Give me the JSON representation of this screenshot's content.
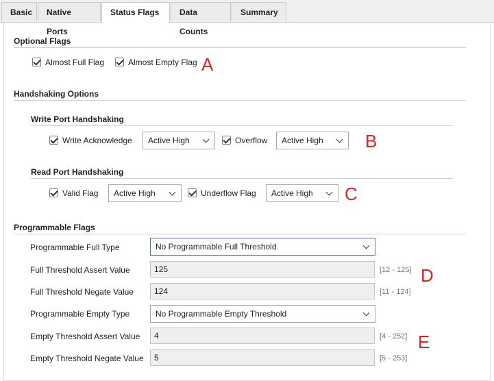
{
  "tabs": [
    "Basic",
    "Native Ports",
    "Status Flags",
    "Data Counts",
    "Summary"
  ],
  "optional_flags": {
    "title": "Optional Flags",
    "almost_full": "Almost Full Flag",
    "almost_empty": "Almost Empty Flag"
  },
  "handshaking": {
    "title": "Handshaking Options",
    "write": {
      "title": "Write Port Handshaking",
      "ack": "Write Acknowledge",
      "ack_select": "Active High",
      "overflow": "Overflow",
      "overflow_select": "Active High"
    },
    "read": {
      "title": "Read Port Handshaking",
      "valid": "Valid Flag",
      "valid_select": "Active High",
      "underflow": "Underflow Flag",
      "underflow_select": "Active High"
    }
  },
  "programmable": {
    "title": "Programmable Flags",
    "full_type_label": "Programmable Full Type",
    "full_type_value": "No Programmable Full Threshold",
    "full_assert_label": "Full Threshold Assert Value",
    "full_assert_value": "125",
    "full_assert_range": "[12 - 125]",
    "full_negate_label": "Full Threshold Negate Value",
    "full_negate_value": "124",
    "full_negate_range": "[11 - 124]",
    "empty_type_label": "Programmable Empty Type",
    "empty_type_value": "No Programmable Empty Threshold",
    "empty_assert_label": "Empty Threshold Assert Value",
    "empty_assert_value": "4",
    "empty_assert_range": "[4 - 252]",
    "empty_negate_label": "Empty Threshold Negate Value",
    "empty_negate_value": "5",
    "empty_negate_range": "[5 - 253]"
  },
  "annotations": [
    "A",
    "B",
    "C",
    "D",
    "E"
  ],
  "colors": {
    "annotation": "#e02222",
    "focus_border": "#4a78b5"
  }
}
